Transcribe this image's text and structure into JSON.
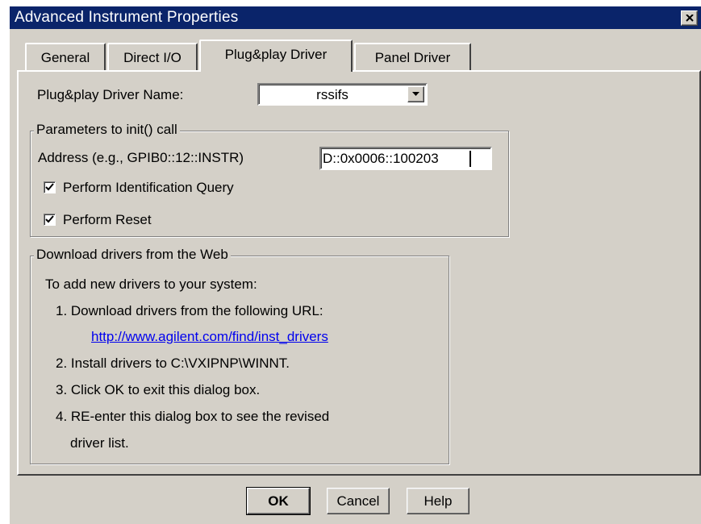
{
  "window": {
    "title": "Advanced Instrument Properties",
    "close_label": "close"
  },
  "tabs": [
    {
      "label": "General",
      "active": false
    },
    {
      "label": "Direct I/O",
      "active": false
    },
    {
      "label": "Plug&play Driver",
      "active": true
    },
    {
      "label": "Panel Driver",
      "active": false
    }
  ],
  "driver_name": {
    "label": "Plug&play Driver Name:",
    "value": "rssifs"
  },
  "init_params": {
    "group_title": "Parameters to init() call",
    "address_label": "Address (e.g., GPIB0::12::INSTR)",
    "address_value": "D::0x0006::100203",
    "identification_query": {
      "label": "Perform Identification Query",
      "checked": true
    },
    "reset": {
      "label": "Perform Reset",
      "checked": true
    }
  },
  "download": {
    "group_title": "Download drivers from the Web",
    "intro": "To add new drivers to your system:",
    "step1": "1. Download drivers from the following URL:",
    "url": "http://www.agilent.com/find/inst_drivers",
    "step2": "2. Install drivers to C:\\VXIPNP\\WINNT.",
    "step3": "3. Click OK to exit this dialog box.",
    "step4_line1": "4. RE-enter this dialog box to see the revised",
    "step4_line2": "driver list."
  },
  "buttons": {
    "ok": "OK",
    "cancel": "Cancel",
    "help": "Help"
  },
  "colors": {
    "title_bar": "#0a246a",
    "dialog_face": "#d4d0c8",
    "link": "#0000ee"
  }
}
